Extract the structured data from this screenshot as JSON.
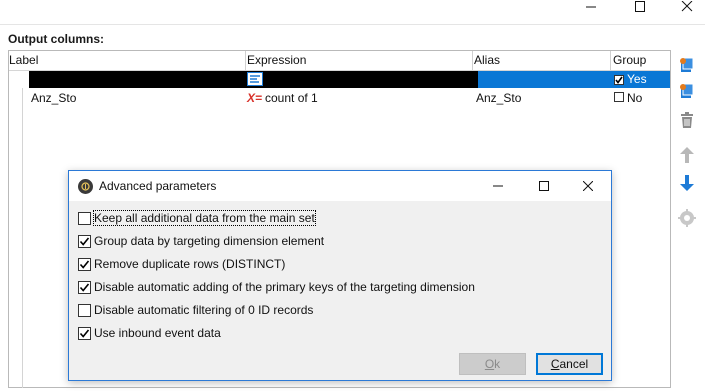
{
  "output_columns_label": "Output columns:",
  "grid": {
    "headers": [
      "Label",
      "Expression",
      "Alias",
      "Group"
    ],
    "rows": [
      {
        "label": "",
        "expression": "",
        "alias": "",
        "group_checked": true,
        "group_text": "Yes",
        "selected": true
      },
      {
        "label": "Anz_Sto",
        "expression_prefix": "X=",
        "expression": "count of 1",
        "alias": "Anz_Sto",
        "group_checked": false,
        "group_text": "No",
        "selected": false
      }
    ]
  },
  "toolbar": {
    "icons": [
      "add-column-icon",
      "add-computed-column-icon",
      "delete-icon",
      "move-up-icon",
      "move-down-icon",
      "settings-icon"
    ]
  },
  "dialog": {
    "title": "Advanced parameters",
    "options": [
      {
        "label": "Keep all additional data from the main set",
        "checked": false
      },
      {
        "label": "Group data by targeting dimension element",
        "checked": true
      },
      {
        "label": "Remove duplicate rows (DISTINCT)",
        "checked": true
      },
      {
        "label": "Disable automatic adding of the primary keys of the targeting dimension",
        "checked": true
      },
      {
        "label": "Disable automatic filtering of 0 ID records",
        "checked": false
      },
      {
        "label": "Use inbound event data",
        "checked": true
      }
    ],
    "ok_label": "Ok",
    "ok_access_key": "O",
    "ok_rest": "k",
    "cancel_label": "Cancel",
    "cancel_access_key": "C",
    "cancel_rest": "ancel"
  },
  "colors": {
    "accent": "#0a77d5",
    "dialog_border": "#2b79d6",
    "expression_red": "#d8312a",
    "toolbar_blue": "#1e7bd6"
  }
}
